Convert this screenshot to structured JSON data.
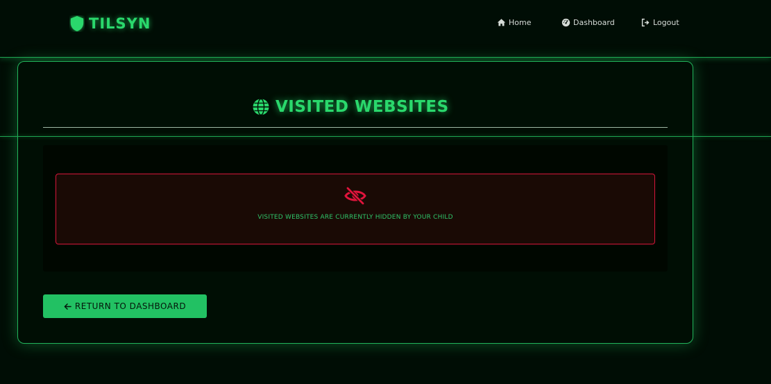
{
  "brand": {
    "name": "TILSYN",
    "icon": "shield-icon"
  },
  "nav": {
    "home": {
      "label": "Home",
      "icon": "home-icon"
    },
    "dashboard": {
      "label": "Dashboard",
      "icon": "gauge-icon"
    },
    "logout": {
      "label": "Logout",
      "icon": "logout-icon"
    }
  },
  "page": {
    "title": "VISITED WEBSITES",
    "title_icon": "globe-icon"
  },
  "alert": {
    "icon": "eye-slash-icon",
    "message": "VISITED WEBSITES ARE CURRENTLY HIDDEN BY YOUR CHILD"
  },
  "actions": {
    "return_label": "RETURN TO DASHBOARD",
    "return_icon": "arrow-left-icon"
  },
  "colors": {
    "accent": "#27d366",
    "background": "#000d05",
    "alert_border": "#d8163a",
    "alert_background": "#1a0a05"
  }
}
